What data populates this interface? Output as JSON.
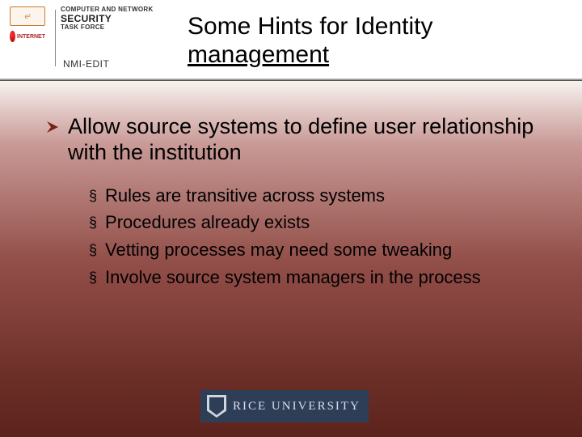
{
  "header": {
    "educause_label": "e²",
    "internet2_label": "INTERNET",
    "security_line1": "Computer and Network",
    "security_line2": "Security",
    "security_line3": "Task Force",
    "nmi": "NMI-EDIT"
  },
  "title": {
    "line1": "Some Hints for Identity",
    "line2": "management"
  },
  "bullets": {
    "main": "Allow source systems to define user relationship with the institution",
    "subs": [
      "Rules are transitive across systems",
      "Procedures already exists",
      "Vetting processes may need some tweaking",
      "Involve source system managers in the process"
    ]
  },
  "footer": {
    "rice": "RICE UNIVERSITY"
  }
}
